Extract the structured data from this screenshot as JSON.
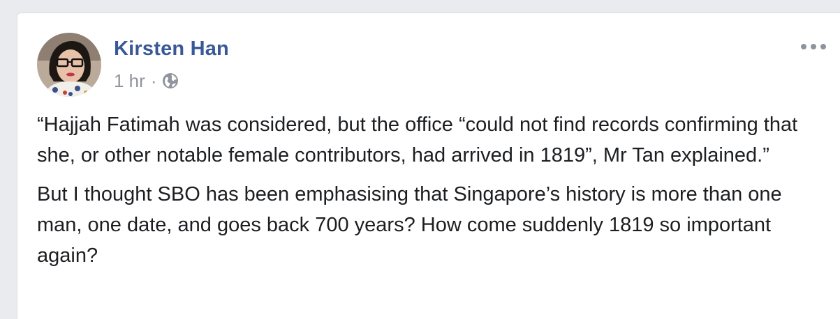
{
  "post": {
    "author_name": "Kirsten Han",
    "timestamp": "1 hr",
    "separator": "·",
    "privacy_icon": "globe-icon",
    "more_icon": "more-horizontal-icon",
    "paragraphs": [
      "“Hajjah Fatimah was considered, but the office “could not find records confirming that she, or other notable female contributors, had arrived in 1819”, Mr Tan explained.”",
      "But I thought SBO has been emphasising that Singapore’s history is more than one man, one date, and goes back 700 years? How come suddenly 1819 so important again?"
    ]
  },
  "colors": {
    "page_background": "#e9ebee",
    "card_background": "#ffffff",
    "author_link": "#385898",
    "meta_text": "#90949c",
    "body_text": "#1c1e21"
  }
}
